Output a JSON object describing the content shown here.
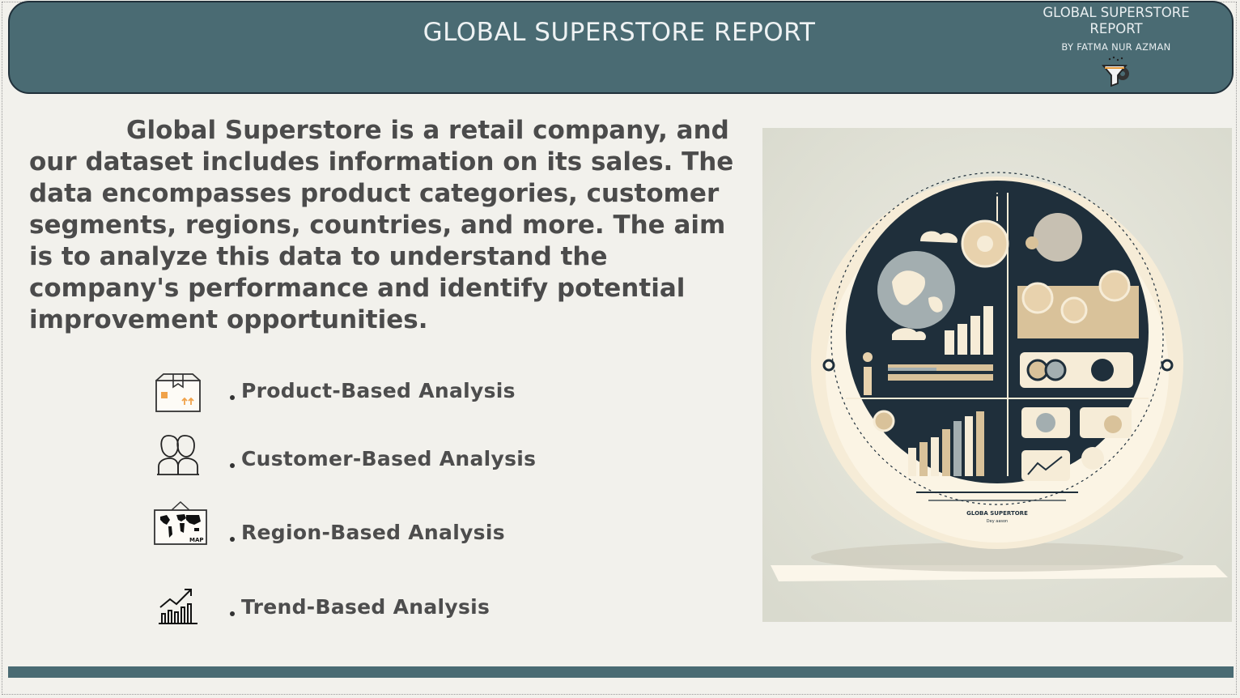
{
  "header": {
    "title": "GLOBAL SUPERSTORE REPORT",
    "brand_title": "GLOBAL SUPERSTORE REPORT",
    "brand_author": "BY FATMA NUR AZMAN",
    "brand_icon": "funnel-gear-icon"
  },
  "intro": {
    "text": "Global Superstore is a retail company, and our dataset includes information on its sales. The data encompasses product categories, customer segments, regions, countries, and more. The aim is to analyze this data to understand the company's performance and identify potential improvement opportunities."
  },
  "analyses": [
    {
      "label": "Product-Based Analysis",
      "icon": "product-box-icon"
    },
    {
      "label": "Customer-Based Analysis",
      "icon": "customers-icon"
    },
    {
      "label": "Region-Based Analysis",
      "icon": "world-map-icon"
    },
    {
      "label": "Trend-Based Analysis",
      "icon": "trend-chart-icon"
    }
  ],
  "illustration": {
    "caption_title": "GLOBA SUPERTORE",
    "caption_sub": "Dey aason"
  },
  "colors": {
    "header_bg": "#4a6b73",
    "page_bg": "#f2f1ec",
    "text": "#4b4b4b",
    "accent_beige": "#e8d2ad",
    "dark_navy": "#1f2f3b"
  }
}
